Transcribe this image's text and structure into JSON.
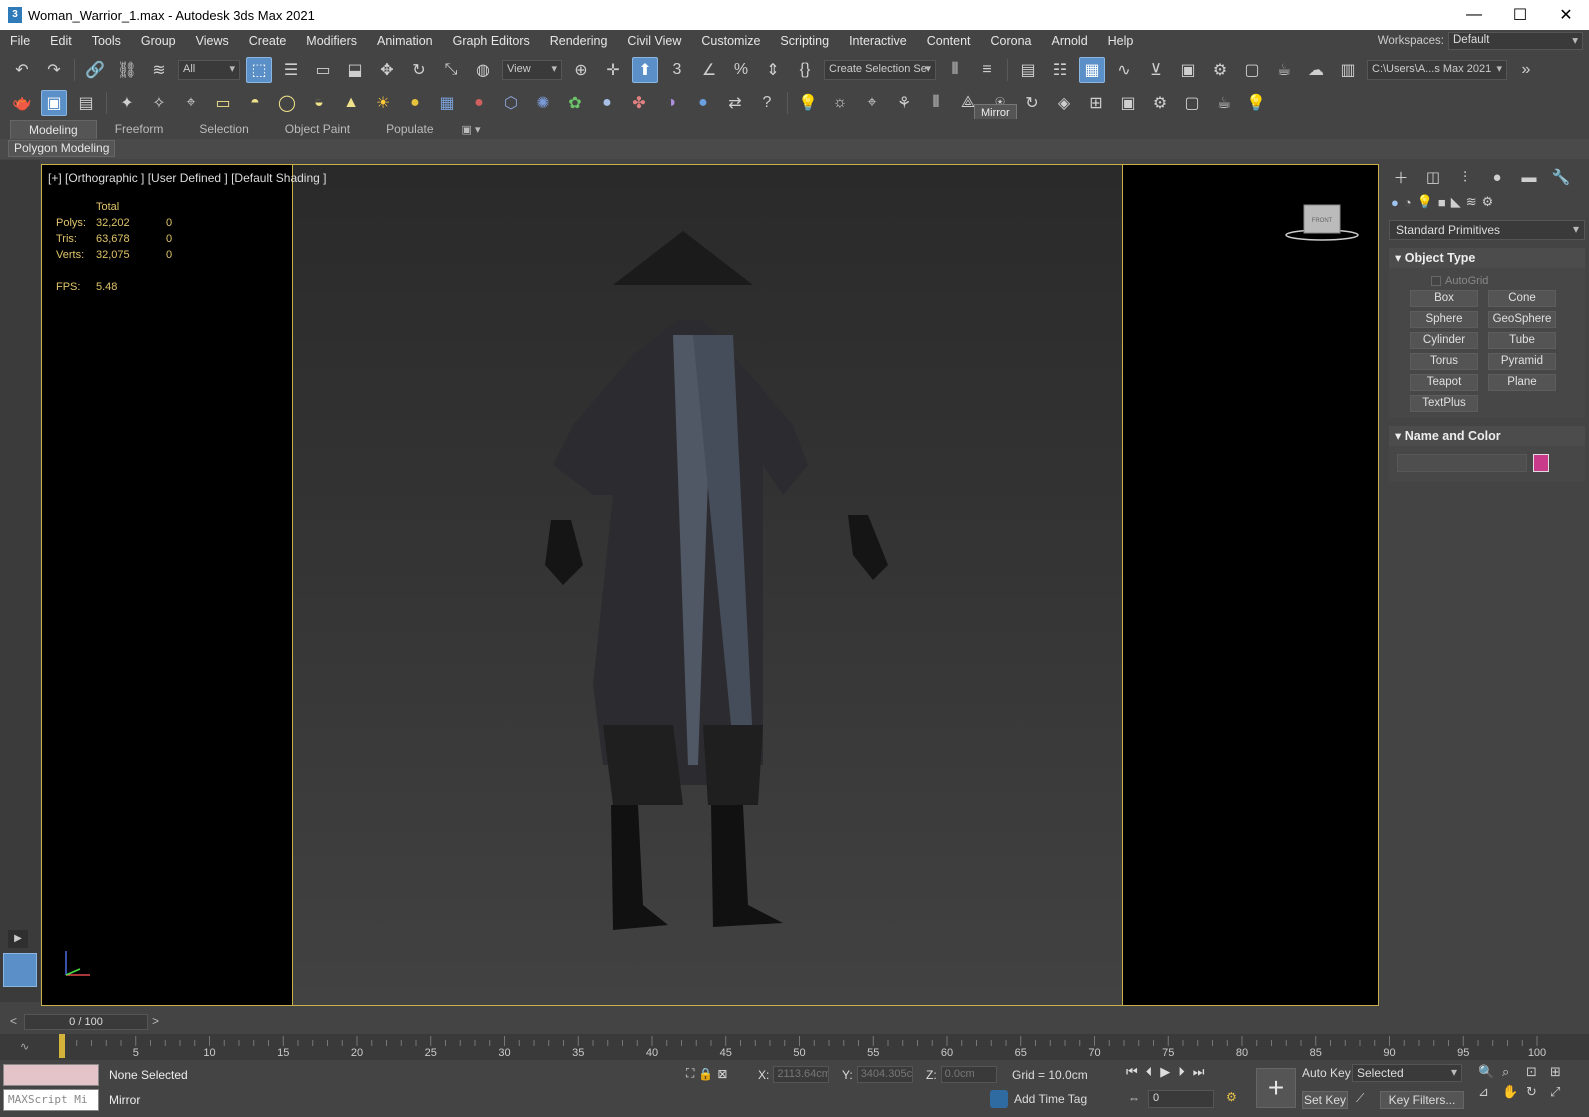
{
  "window": {
    "app_icon": "3",
    "title": "Woman_Warrior_1.max - Autodesk 3ds Max 2021",
    "minimize": "—",
    "maximize": "☐",
    "close": "✕"
  },
  "menu": [
    "File",
    "Edit",
    "Tools",
    "Group",
    "Views",
    "Create",
    "Modifiers",
    "Animation",
    "Graph Editors",
    "Rendering",
    "Civil View",
    "Customize",
    "Scripting",
    "Interactive",
    "Content",
    "Corona",
    "Arnold",
    "Help"
  ],
  "workspaces": {
    "label": "Workspaces:",
    "value": "Default"
  },
  "toolbar": {
    "selection_filter": "All",
    "ref_coord": "View",
    "named_selection": "Create Selection Se",
    "project_path": "C:\\Users\\A...s Max 2021",
    "tooltip": "Mirror"
  },
  "ribbon": {
    "tabs": [
      "Modeling",
      "Freeform",
      "Selection",
      "Object Paint",
      "Populate"
    ],
    "active_tab": "Modeling",
    "panel_label": "Polygon Modeling"
  },
  "viewport": {
    "label": "[+] [Orthographic ] [User Defined ] [Default Shading ]",
    "stats": {
      "header": "Total",
      "rows": [
        {
          "label": "Polys:",
          "total": "32,202",
          "sel": "0"
        },
        {
          "label": "Tris:",
          "total": "63,678",
          "sel": "0"
        },
        {
          "label": "Verts:",
          "total": "32,075",
          "sel": "0"
        }
      ],
      "fps_label": "FPS:",
      "fps_value": "5.48"
    },
    "viewcube_label": "FRONT"
  },
  "command_panel": {
    "category": "Standard Primitives",
    "object_type_title": "Object Type",
    "autogrid_label": "AutoGrid",
    "objects": [
      "Box",
      "Cone",
      "Sphere",
      "GeoSphere",
      "Cylinder",
      "Tube",
      "Torus",
      "Pyramid",
      "Teapot",
      "Plane",
      "TextPlus"
    ],
    "name_color_title": "Name and Color",
    "object_color": "#c93a8a"
  },
  "timeline": {
    "frame_display": "0 / 100",
    "ticks": [
      "0",
      "5",
      "10",
      "15",
      "20",
      "25",
      "30",
      "35",
      "40",
      "45",
      "50",
      "55",
      "60",
      "65",
      "70",
      "75",
      "80",
      "85",
      "90",
      "95",
      "100"
    ],
    "current_frame": 0
  },
  "status": {
    "selection": "None Selected",
    "prompt": "Mirror",
    "maxscript_placeholder": "MAXScript Mi",
    "x_label": "X:",
    "x_value": "2113.64cm",
    "y_label": "Y:",
    "y_value": "3404.305c",
    "z_label": "Z:",
    "z_value": "0.0cm",
    "grid": "Grid = 10.0cm",
    "add_time_tag": "Add Time Tag",
    "auto_key": "Auto Key",
    "set_key": "Set Key",
    "selected_dropdown": "Selected",
    "key_filters": "Key Filters...",
    "frame_value": "0"
  }
}
